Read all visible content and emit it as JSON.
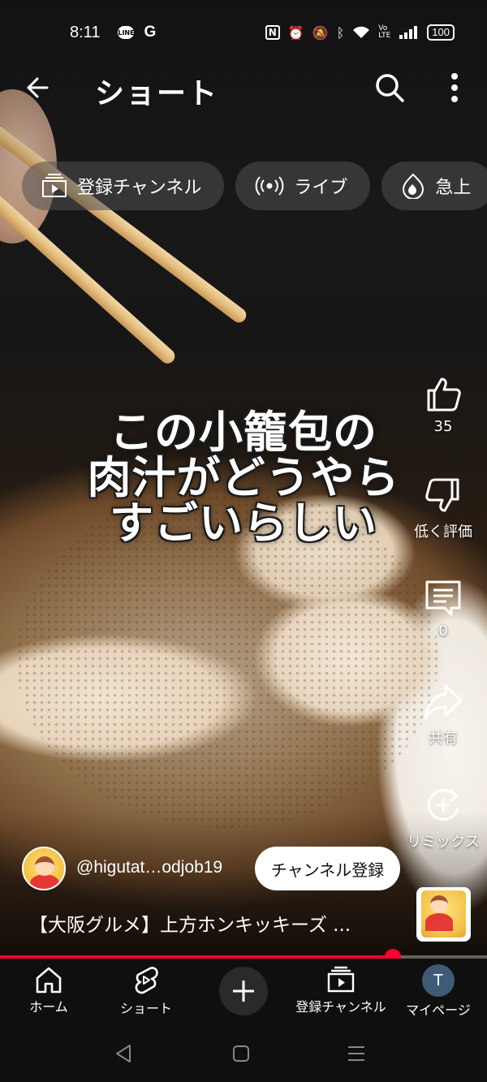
{
  "status_bar": {
    "time": "8:11",
    "line_badge": "LINE",
    "google_badge": "G",
    "nfc": "N",
    "volte": "Vo LTE",
    "battery": "100"
  },
  "header": {
    "title": "ショート"
  },
  "chips": [
    {
      "label": "登録チャンネル",
      "icon": "subscriptions-icon"
    },
    {
      "label": "ライブ",
      "icon": "live-icon"
    },
    {
      "label": "急上",
      "icon": "trending-icon"
    }
  ],
  "video": {
    "caption_lines": [
      "この小籠包の",
      "肉汁がどうやら",
      "すごいらしい"
    ]
  },
  "actions": {
    "like_count": "35",
    "dislike_label": "低く評価",
    "comment_count": "0",
    "share_label": "共有",
    "remix_label": "リミックス"
  },
  "channel": {
    "handle": "@higutat…odjob19",
    "subscribe_label": "チャンネル登録"
  },
  "video_title": "【大阪グルメ】上方ホンキッキーズ ...",
  "progress": {
    "fraction": 0.807
  },
  "bottom_nav": [
    {
      "label": "ホーム"
    },
    {
      "label": "ショート"
    },
    {
      "label": "登録チャンネル"
    },
    {
      "label": "マイページ"
    }
  ],
  "me_initial": "T",
  "colors": {
    "accent_red": "#ff0033",
    "nav_bg": "#0f0f0f",
    "subscribe_bg": "#ffffff"
  }
}
